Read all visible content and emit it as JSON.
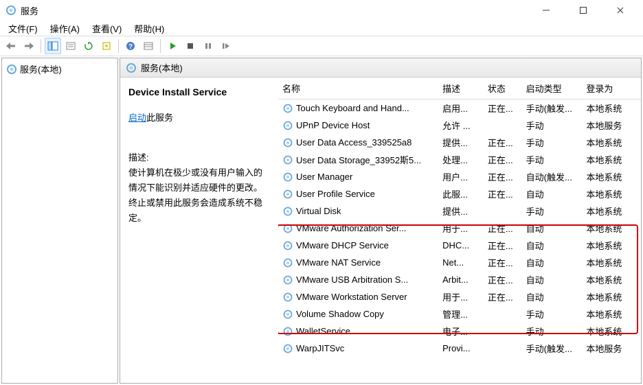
{
  "window": {
    "title": "服务"
  },
  "menu": {
    "file": "文件(F)",
    "action": "操作(A)",
    "view": "查看(V)",
    "help": "帮助(H)"
  },
  "sidebar": {
    "item0": "服务(本地)"
  },
  "content": {
    "header": "服务(本地)"
  },
  "detail": {
    "service_name": "Device Install Service",
    "action_link": "启动",
    "action_suffix": "此服务",
    "desc_label": "描述:",
    "desc_text": "使计算机在极少或没有用户输入的情况下能识别并适应硬件的更改。终止或禁用此服务会造成系统不稳定。"
  },
  "columns": {
    "name": "名称",
    "desc": "描述",
    "status": "状态",
    "startup": "启动类型",
    "logon": "登录为"
  },
  "services": {
    "s0": {
      "name": "Touch Keyboard and Hand...",
      "desc": "启用...",
      "status": "正在...",
      "startup": "手动(触发...",
      "logon": "本地系统"
    },
    "s1": {
      "name": "UPnP Device Host",
      "desc": "允许 ...",
      "status": "",
      "startup": "手动",
      "logon": "本地服务"
    },
    "s2": {
      "name": "User Data Access_339525a8",
      "desc": "提供...",
      "status": "正在...",
      "startup": "手动",
      "logon": "本地系统"
    },
    "s3": {
      "name": "User Data Storage_33952斯5...",
      "desc": "处理...",
      "status": "正在...",
      "startup": "手动",
      "logon": "本地系统"
    },
    "s4": {
      "name": "User Manager",
      "desc": "用户...",
      "status": "正在...",
      "startup": "自动(触发...",
      "logon": "本地系统"
    },
    "s5": {
      "name": "User Profile Service",
      "desc": "此服...",
      "status": "正在...",
      "startup": "自动",
      "logon": "本地系统"
    },
    "s6": {
      "name": "Virtual Disk",
      "desc": "提供...",
      "status": "",
      "startup": "手动",
      "logon": "本地系统"
    },
    "s7": {
      "name": "VMware Authorization Ser...",
      "desc": "用于...",
      "status": "正在...",
      "startup": "自动",
      "logon": "本地系统"
    },
    "s8": {
      "name": "VMware DHCP Service",
      "desc": "DHC...",
      "status": "正在...",
      "startup": "自动",
      "logon": "本地系统"
    },
    "s9": {
      "name": "VMware NAT Service",
      "desc": "Net...",
      "status": "正在...",
      "startup": "自动",
      "logon": "本地系统"
    },
    "s10": {
      "name": "VMware USB Arbitration S...",
      "desc": "Arbit...",
      "status": "正在...",
      "startup": "自动",
      "logon": "本地系统"
    },
    "s11": {
      "name": "VMware Workstation Server",
      "desc": "用于...",
      "status": "正在...",
      "startup": "自动",
      "logon": "本地系统"
    },
    "s12": {
      "name": "Volume Shadow Copy",
      "desc": "管理...",
      "status": "",
      "startup": "手动",
      "logon": "本地系统"
    },
    "s13": {
      "name": "WalletService",
      "desc": "电子...",
      "status": "",
      "startup": "手动",
      "logon": "本地系统"
    },
    "s14": {
      "name": "WarpJITSvc",
      "desc": "Provi...",
      "status": "",
      "startup": "手动(触发...",
      "logon": "本地服务"
    }
  }
}
